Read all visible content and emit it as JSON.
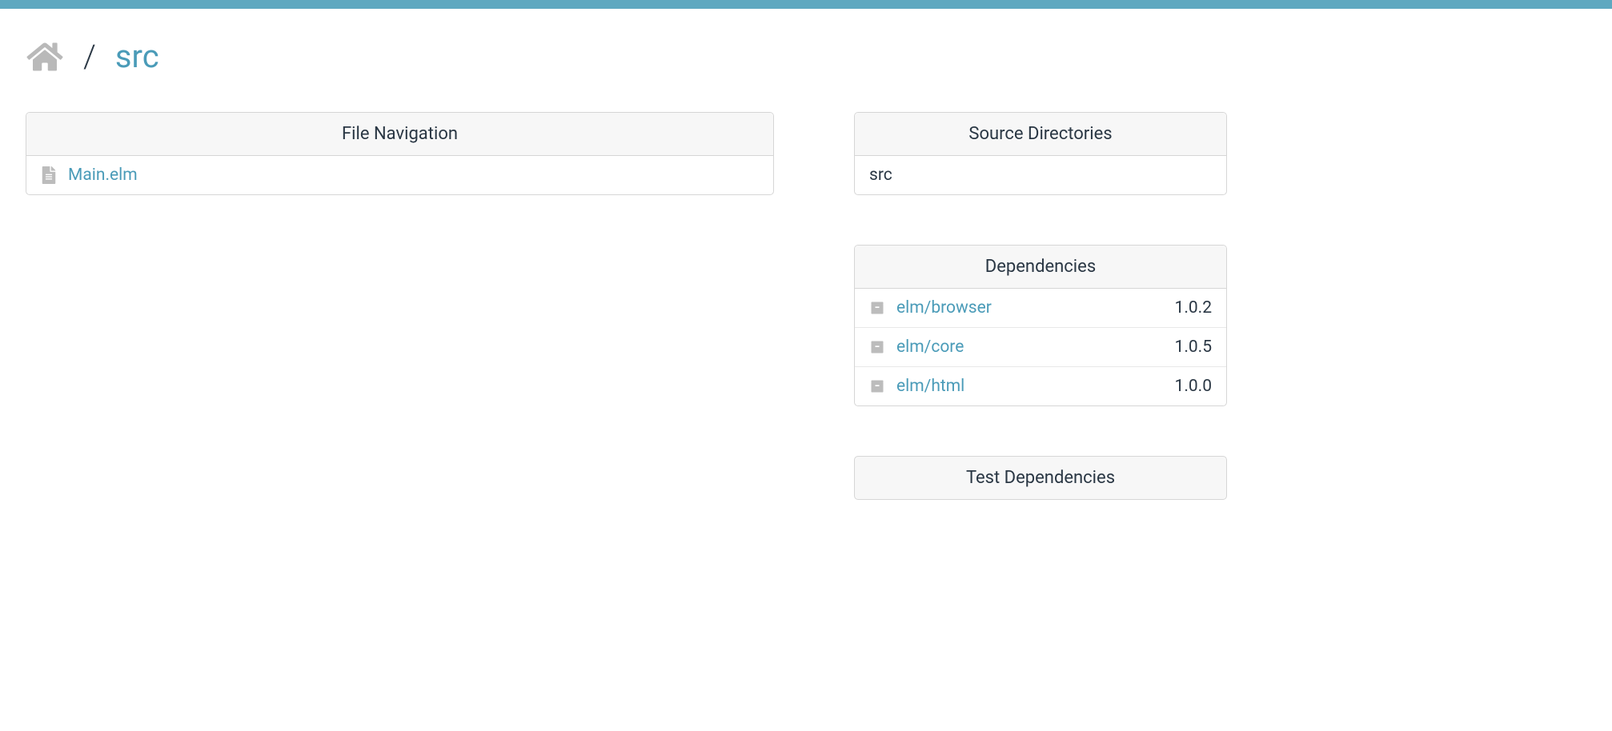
{
  "breadcrumb": {
    "separator": "/",
    "current": "src"
  },
  "panels": {
    "file_nav_title": "File Navigation",
    "source_dirs_title": "Source Directories",
    "dependencies_title": "Dependencies",
    "test_dependencies_title": "Test Dependencies"
  },
  "files": [
    {
      "name": "Main.elm"
    }
  ],
  "source_directories": [
    {
      "path": "src"
    }
  ],
  "dependencies": [
    {
      "name": "elm/browser",
      "version": "1.0.2"
    },
    {
      "name": "elm/core",
      "version": "1.0.5"
    },
    {
      "name": "elm/html",
      "version": "1.0.0"
    }
  ]
}
